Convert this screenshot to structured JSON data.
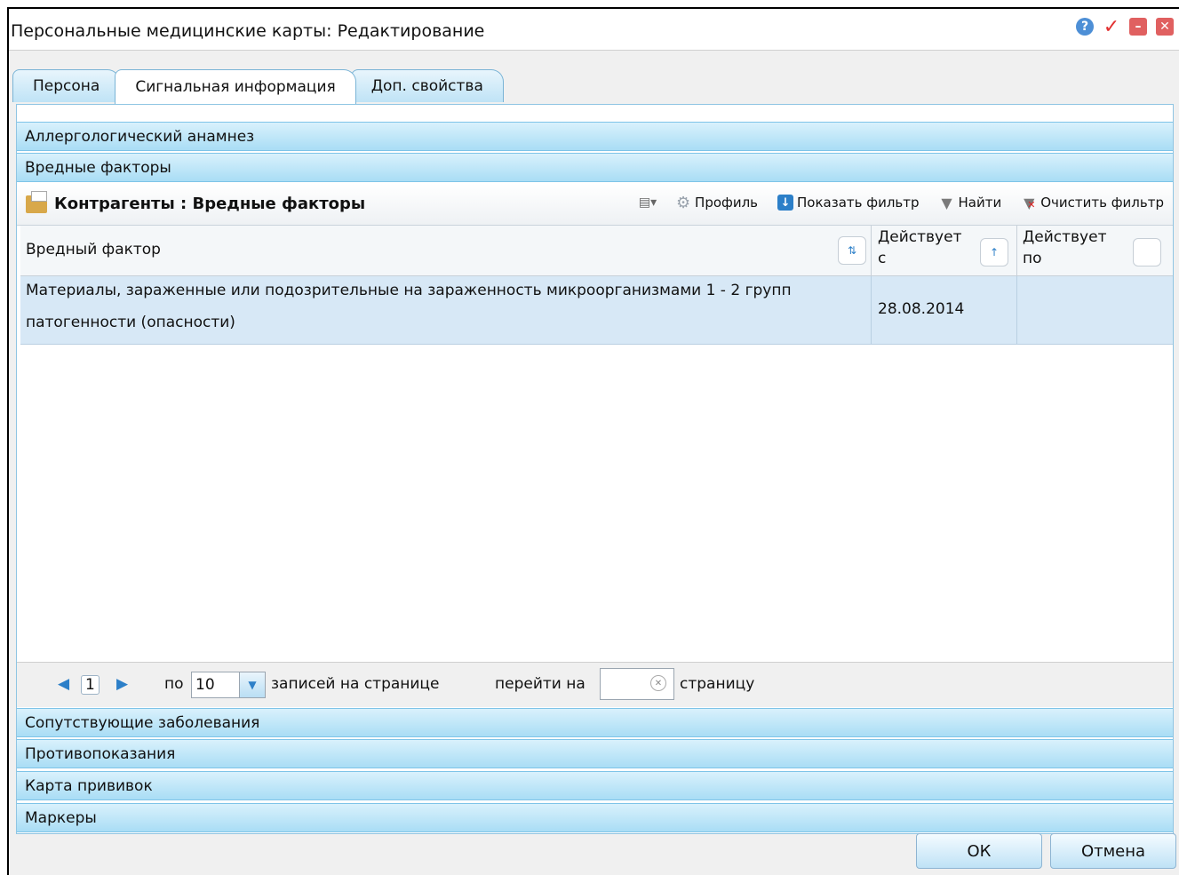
{
  "window": {
    "title": "Персональные медицинские карты: Редактирование"
  },
  "tabs": [
    {
      "label": "Персона",
      "active": false
    },
    {
      "label": "Сигнальная информация",
      "active": true
    },
    {
      "label": "Доп. свойства",
      "active": false
    }
  ],
  "accordion_top": [
    {
      "label": "Аллергологический анамнез"
    },
    {
      "label": "Вредные факторы"
    }
  ],
  "grid": {
    "title": "Контрагенты : Вредные факторы",
    "toolbar": {
      "profile": "Профиль",
      "show_filter": "Показать фильтр",
      "find": "Найти",
      "clear_filter": "Очистить фильтр"
    },
    "columns": {
      "factor": "Вредный фактор",
      "from_line1": "Действует",
      "from_line2": "с",
      "to_line1": "Действует",
      "to_line2": "по"
    },
    "rows": [
      {
        "factor_line1": "Материалы, зараженные или подозрительные на зараженность микроорганизмами 1 - 2 групп",
        "factor_line2": "патогенности (опасности)",
        "from": "28.08.2014",
        "to": ""
      }
    ]
  },
  "pager": {
    "page": "1",
    "per_label": "по",
    "page_size": "10",
    "records_label": "записей на странице",
    "goto_label": "перейти на",
    "goto_value": "",
    "page_label": "страницу"
  },
  "accordion_bottom": [
    {
      "label": "Сопутствующие заболевания"
    },
    {
      "label": "Противопоказания"
    },
    {
      "label": "Карта прививок"
    },
    {
      "label": "Маркеры"
    }
  ],
  "buttons": {
    "ok": "ОК",
    "cancel": "Отмена"
  },
  "colors": {
    "accordion_header": "#a9ddf5",
    "selected_row": "#d7e8f6",
    "accent_blue": "#2c7fc8"
  }
}
